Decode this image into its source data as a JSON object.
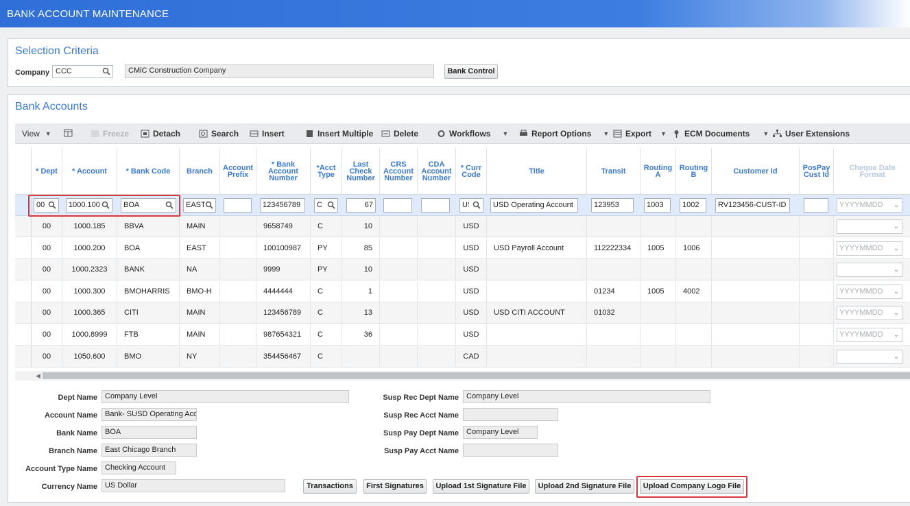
{
  "app": {
    "title": "BANK ACCOUNT MAINTENANCE"
  },
  "selection": {
    "title": "Selection Criteria",
    "company_label": "Company",
    "company_code": "CCC",
    "company_name": "CMiC Construction Company",
    "bank_control_button": "Bank Control"
  },
  "bank_accounts": {
    "title": "Bank Accounts",
    "toolbar": {
      "view": "View",
      "freeze": "Freeze",
      "detach": "Detach",
      "search": "Search",
      "insert": "Insert",
      "insert_multiple": "Insert Multiple",
      "delete": "Delete",
      "workflows": "Workflows",
      "report_options": "Report Options",
      "export": "Export",
      "ecm_documents": "ECM Documents",
      "user_extensions": "User Extensions"
    },
    "headers": {
      "dept": "* Dept",
      "account": "* Account",
      "bank_code": "* Bank Code",
      "branch": "Branch",
      "account_prefix": "Account Prefix",
      "bank_account_number": "* Bank Account Number",
      "acct_type": "*Acct Type",
      "last_check_number": "Last Check Number",
      "crs_account_number": "CRS Account Number",
      "cda_account_number": "CDA Account Number",
      "curr_code": "* Curr Code",
      "title": "Title",
      "transit": "Transit",
      "routing_a": "Routing A",
      "routing_b": "Routing B",
      "customer_id": "Customer Id",
      "pospay_cust_id": "PosPay Cust Id",
      "cheque_date_format": "Cheque Date Format"
    },
    "edit_row": {
      "dept": "00",
      "account": "1000.100",
      "bank_code": "BOA",
      "branch": "EAST",
      "account_prefix": "",
      "bank_account_number": "123456789",
      "acct_type": "C",
      "last_check_number": "67",
      "crs_account_number": "",
      "cda_account_number": "",
      "curr_code": "USD",
      "title": "USD Operating Account",
      "transit": "123953",
      "routing_a": "1003",
      "routing_b": "1002",
      "customer_id": "RV123456-CUST-ID",
      "pospay_cust_id": "",
      "cheque_date_format": "YYYYMMDD"
    },
    "rows": [
      {
        "dept": "00",
        "account": "1000.185",
        "bank_code": "BBVA",
        "branch": "MAIN",
        "bank_account_number": "9658749",
        "acct_type": "C",
        "last_check_number": "10",
        "curr_code": "USD",
        "title": "",
        "transit": "",
        "routing_a": "",
        "routing_b": "",
        "cheque_date_format": ""
      },
      {
        "dept": "00",
        "account": "1000.200",
        "bank_code": "BOA",
        "branch": "EAST",
        "bank_account_number": "100100987",
        "acct_type": "PY",
        "last_check_number": "85",
        "curr_code": "USD",
        "title": "USD Payroll Account",
        "transit": "112222334",
        "routing_a": "1005",
        "routing_b": "1006",
        "cheque_date_format": "YYYYMMDD"
      },
      {
        "dept": "00",
        "account": "1000.2323",
        "bank_code": "BANK",
        "branch": "NA",
        "bank_account_number": "9999",
        "acct_type": "PY",
        "last_check_number": "10",
        "curr_code": "USD",
        "title": "",
        "transit": "",
        "routing_a": "",
        "routing_b": "",
        "cheque_date_format": ""
      },
      {
        "dept": "00",
        "account": "1000.300",
        "bank_code": "BMOHARRIS",
        "branch": "BMO-H",
        "bank_account_number": "4444444",
        "acct_type": "C",
        "last_check_number": "1",
        "curr_code": "USD",
        "title": "",
        "transit": "01234",
        "routing_a": "1005",
        "routing_b": "4002",
        "cheque_date_format": "YYYYMMDD"
      },
      {
        "dept": "00",
        "account": "1000.365",
        "bank_code": "CITI",
        "branch": "MAIN",
        "bank_account_number": "123456789",
        "acct_type": "C",
        "last_check_number": "13",
        "curr_code": "USD",
        "title": "USD CITI ACCOUNT",
        "transit": "01032",
        "routing_a": "",
        "routing_b": "",
        "cheque_date_format": "YYYYMMDD"
      },
      {
        "dept": "00",
        "account": "1000.8999",
        "bank_code": "FTB",
        "branch": "MAIN",
        "bank_account_number": "987654321",
        "acct_type": "C",
        "last_check_number": "36",
        "curr_code": "USD",
        "title": "",
        "transit": "",
        "routing_a": "",
        "routing_b": "",
        "cheque_date_format": "YYYYMMDD"
      },
      {
        "dept": "00",
        "account": "1050.600",
        "bank_code": "BMO",
        "branch": "NY",
        "bank_account_number": "354456467",
        "acct_type": "C",
        "last_check_number": "",
        "curr_code": "CAD",
        "title": "",
        "transit": "",
        "routing_a": "",
        "routing_b": "",
        "cheque_date_format": ""
      }
    ]
  },
  "details": {
    "dept_name_label": "Dept Name",
    "dept_name": "Company Level",
    "account_name_label": "Account Name",
    "account_name": "Bank- SUSD Operating Acc",
    "bank_name_label": "Bank Name",
    "bank_name": "BOA",
    "branch_name_label": "Branch Name",
    "branch_name": "East Chicago Branch",
    "account_type_name_label": "Account Type Name",
    "account_type_name": "Checking Account",
    "currency_name_label": "Currency Name",
    "currency_name": "US Dollar",
    "susp_rec_dept_name_label": "Susp Rec Dept Name",
    "susp_rec_dept_name": "Company Level",
    "susp_rec_acct_name_label": "Susp Rec Acct Name",
    "susp_rec_acct_name": "",
    "susp_pay_dept_name_label": "Susp Pay Dept Name",
    "susp_pay_dept_name": "Company Level",
    "susp_pay_acct_name_label": "Susp Pay Acct Name",
    "susp_pay_acct_name": ""
  },
  "actions": {
    "transactions": "Transactions",
    "first_signatures": "First Signatures",
    "upload_1st_signature": "Upload 1st Signature File",
    "upload_2nd_signature": "Upload 2nd Signature File",
    "upload_company_logo": "Upload Company Logo File"
  },
  "colors": {
    "accent": "#3b7ad6",
    "header_bar": "#2f6fd8",
    "highlight": "#d8373b",
    "selected_row": "#dfeafb"
  }
}
